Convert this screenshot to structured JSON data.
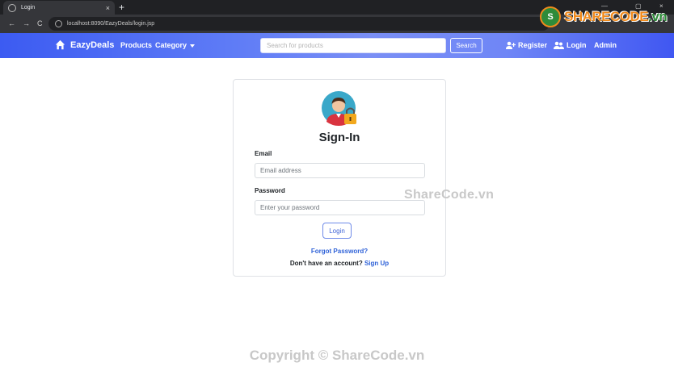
{
  "browser": {
    "tab_title": "Login",
    "tab_close": "×",
    "new_tab": "+",
    "back": "←",
    "forward": "→",
    "reload": "C",
    "url": "localhost:8090/EazyDeals/login.jsp",
    "win_min": "—",
    "win_restore": "▢",
    "win_close": "×"
  },
  "watermark": {
    "logo_main": "SHARECODE",
    "logo_vn": ".vn",
    "logo_mark": "S",
    "mid": "ShareCode.vn",
    "bottom": "Copyright © ShareCode.vn"
  },
  "navbar": {
    "brand": "EazyDeals",
    "products": "Products",
    "category": "Category",
    "search_placeholder": "Search for products",
    "search_button": "Search",
    "register": "Register",
    "login": "Login",
    "admin": "Admin"
  },
  "login_card": {
    "title": "Sign-In",
    "email_label": "Email",
    "email_placeholder": "Email address",
    "password_label": "Password",
    "password_placeholder": "Enter your password",
    "login_button": "Login",
    "forgot": "Forgot Password?",
    "no_account": "Don't have an account?",
    "signup": "Sign Up"
  },
  "colors": {
    "navbar_start": "#3c5bf2",
    "navbar_end": "#4057f2",
    "link": "#2f62d8"
  }
}
